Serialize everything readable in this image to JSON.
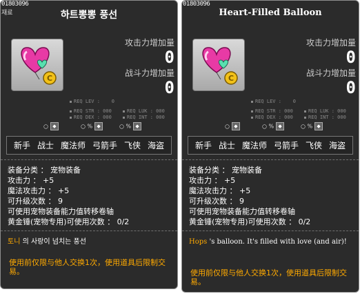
{
  "left": {
    "id": "01803096",
    "tag": "재료",
    "title": "하트뽕뽕 풍선",
    "stat1_label": "攻击力增加量",
    "stat1_value": "0",
    "stat2_label": "战斗力增加量",
    "stat2_value": "0",
    "req_lev": "REQ LEV :",
    "req_lev_val": "0",
    "req_str": "REQ STR : 000",
    "req_luk": "REQ LUK : 000",
    "req_dex": "REQ DEX : 000",
    "req_int": "REQ INT : 000",
    "job_marks": [
      "○",
      "○ %",
      "○ %"
    ],
    "jobs": [
      "新手",
      "战士",
      "魔法师",
      "弓箭手",
      "飞侠",
      "海盗"
    ],
    "props": [
      "装备分类 ： 宠物装备",
      "攻击力 ： +5",
      "魔法攻击力 ： +5",
      "可升级次数 ： 9",
      "可使用宠物装备能力值转移卷轴",
      "黄金锤(宠物专用)可使用次数 ： 0/2"
    ],
    "desc_highlight": "토니",
    "desc_rest": " 의 사랑이 넘치는 풍선",
    "trade": "使用前仅限与他人交换1次，使用道具后限制交易。"
  },
  "right": {
    "id": "01803096",
    "title": "Heart-Filled Balloon",
    "stat1_label": "攻击力增加量",
    "stat1_value": "0",
    "stat2_label": "战斗力增加量",
    "stat2_value": "0",
    "req_lev": "REQ LEV :",
    "req_lev_val": "0",
    "req_str": "REQ STR : 000",
    "req_luk": "REQ LUK : 000",
    "req_dex": "REQ DEX : 000",
    "req_int": "REQ INT : 000",
    "job_marks": [
      "○",
      "○ %",
      "○ %"
    ],
    "jobs": [
      "新手",
      "战士",
      "魔法师",
      "弓箭手",
      "飞侠",
      "海盗"
    ],
    "props": [
      "装备分类 ： 宠物装备",
      "攻击力 ： +5",
      "魔法攻击力 ： +5",
      "可升级次数 ： 9",
      "可使用宠物装备能力值转移卷轴",
      "黄金锤(宠物专用)可使用次数 ： 0/2"
    ],
    "desc_highlight": "Hops",
    "desc_rest": " 's balloon. It's filled with love (and air)!",
    "trade": "使用前仅限与他人交换1次，使用道具后限制交易。"
  },
  "colors": {
    "panel": "#2b2b2b",
    "highlight": "#ffaa00",
    "border": "#8f8f8f"
  },
  "icons": [
    "heart-balloon-icon",
    "coin-icon",
    "job-icon"
  ]
}
